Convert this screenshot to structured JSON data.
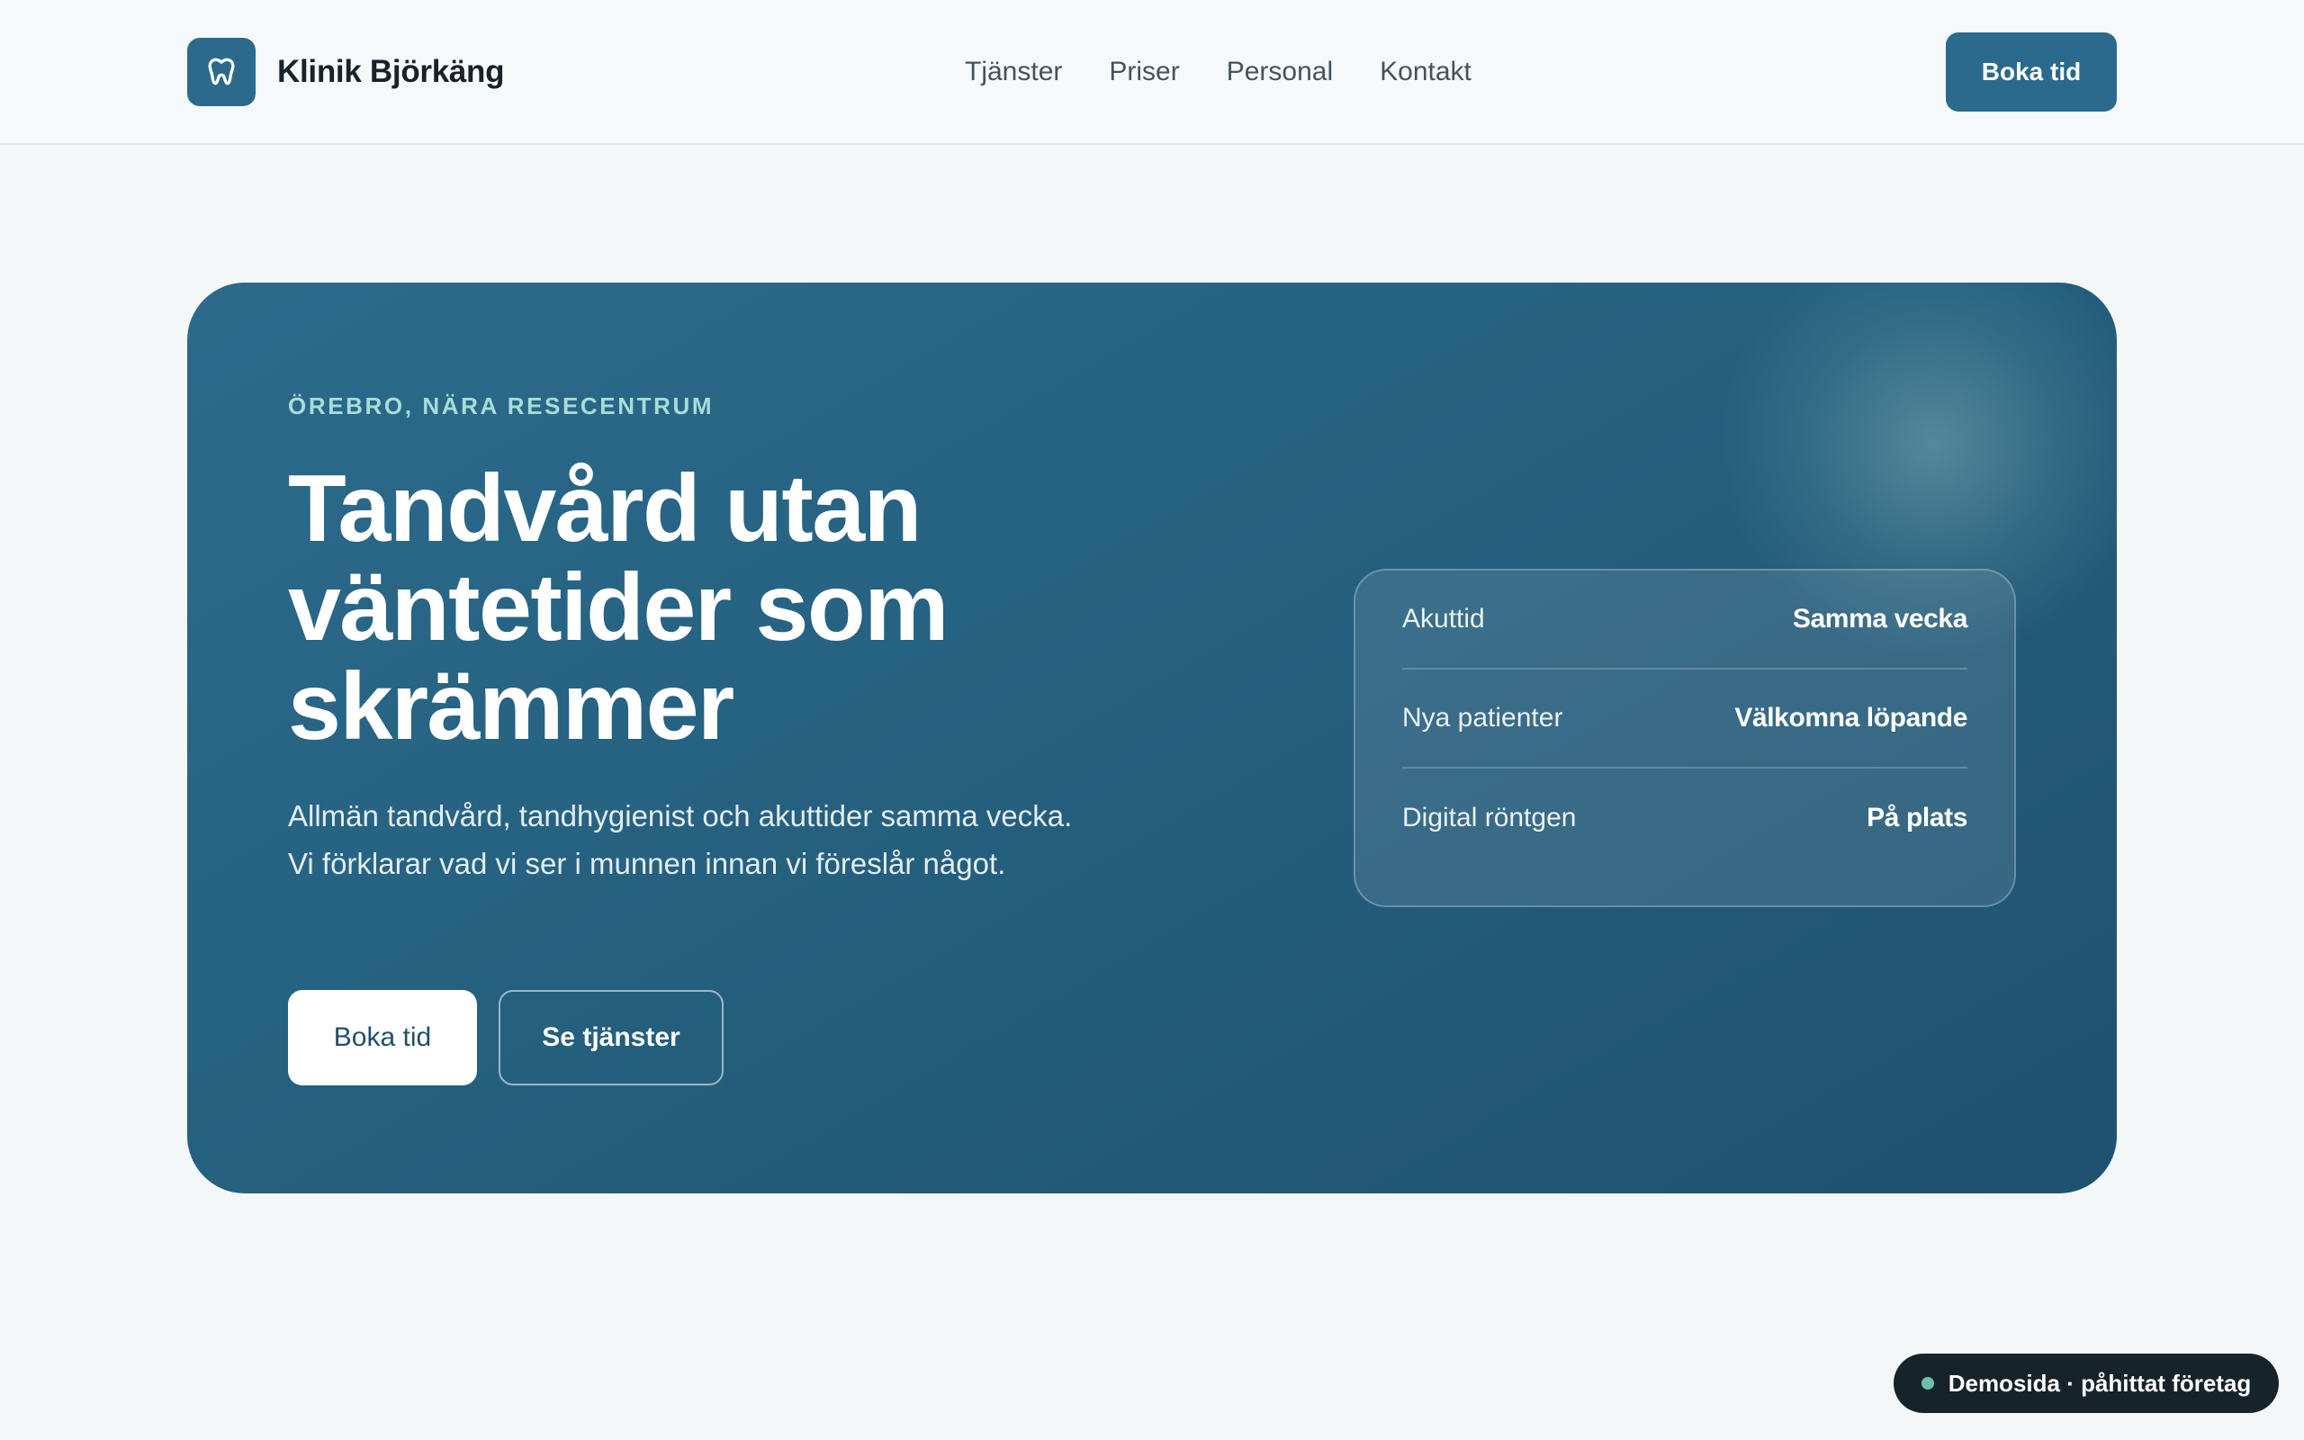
{
  "brand": {
    "name": "Klinik Björkäng",
    "logo_icon": "tooth-icon",
    "accent_color": "#2b6a8d"
  },
  "nav": {
    "items": [
      {
        "label": "Tjänster"
      },
      {
        "label": "Priser"
      },
      {
        "label": "Personal"
      },
      {
        "label": "Kontakt"
      }
    ],
    "cta_label": "Boka tid"
  },
  "hero": {
    "eyebrow": "ÖREBRO, NÄRA RESECENTRUM",
    "title_lines": [
      "Tandvård utan",
      "väntetider som",
      "skrämmer"
    ],
    "lead": "Allmän tandvård, tandhygienist och akuttider samma vecka. Vi förklarar vad vi ser i munnen innan vi föreslår något.",
    "primary_button": "Boka tid",
    "secondary_button": "Se tjänster",
    "info_card": [
      {
        "label": "Akuttid",
        "value": "Samma vecka"
      },
      {
        "label": "Nya patienter",
        "value": "Välkomna löpande"
      },
      {
        "label": "Digital röntgen",
        "value": "På plats"
      }
    ]
  },
  "demo_badge": {
    "text": "Demosida · påhittat företag",
    "dot_color": "#6cc2a6"
  }
}
